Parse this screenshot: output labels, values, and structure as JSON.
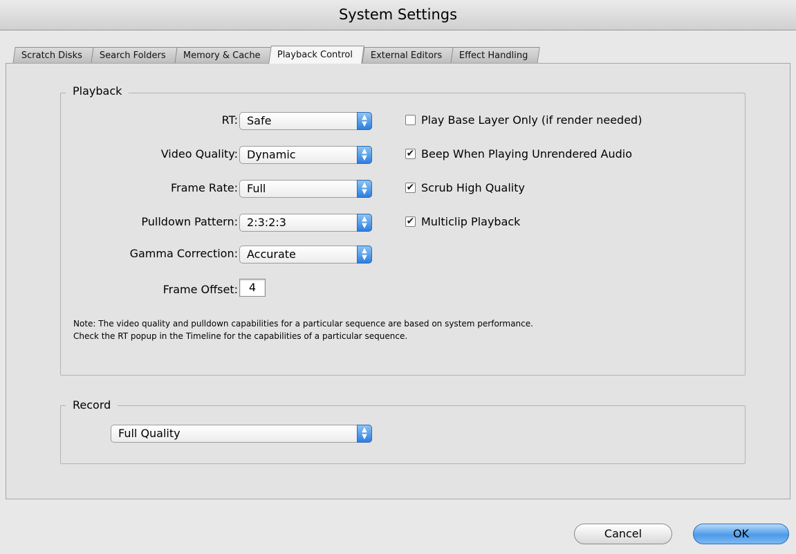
{
  "window": {
    "title": "System Settings"
  },
  "tabs": [
    {
      "label": "Scratch Disks",
      "active": false
    },
    {
      "label": "Search Folders",
      "active": false
    },
    {
      "label": "Memory & Cache",
      "active": false
    },
    {
      "label": "Playback Control",
      "active": true
    },
    {
      "label": "External Editors",
      "active": false
    },
    {
      "label": "Effect Handling",
      "active": false
    }
  ],
  "playback": {
    "title": "Playback",
    "rt": {
      "label": "RT:",
      "value": "Safe"
    },
    "video_quality": {
      "label": "Video Quality:",
      "value": "Dynamic"
    },
    "frame_rate": {
      "label": "Frame Rate:",
      "value": "Full"
    },
    "pulldown_pattern": {
      "label": "Pulldown Pattern:",
      "value": "2:3:2:3"
    },
    "gamma_correction": {
      "label": "Gamma Correction:",
      "value": "Accurate"
    },
    "frame_offset": {
      "label": "Frame Offset:",
      "value": "4"
    },
    "checkboxes": [
      {
        "label": "Play Base Layer Only (if render needed)",
        "checked": false
      },
      {
        "label": "Beep When Playing Unrendered Audio",
        "checked": true
      },
      {
        "label": "Scrub High Quality",
        "checked": true
      },
      {
        "label": "Multiclip Playback",
        "checked": true
      }
    ],
    "note_line1": "Note: The video quality and pulldown capabilities for a particular sequence are based on system performance.",
    "note_line2": "Check the RT popup in the Timeline for the capabilities of a particular sequence."
  },
  "record": {
    "title": "Record",
    "value": "Full Quality"
  },
  "buttons": {
    "cancel": "Cancel",
    "ok": "OK"
  },
  "glyphs": {
    "check": "✔",
    "arrow_up": "▲",
    "arrow_down": "▼"
  }
}
